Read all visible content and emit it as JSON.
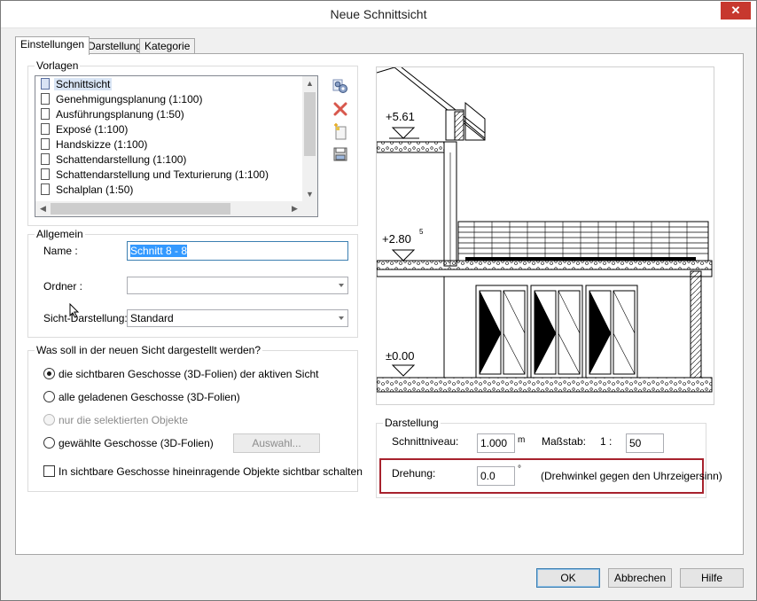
{
  "window": {
    "title": "Neue Schnittsicht",
    "close_glyph": "✕"
  },
  "tabs": [
    "Einstellungen",
    "Darstellung",
    "Kategorie"
  ],
  "vorlagen": {
    "legend": "Vorlagen",
    "items": [
      "Schnittsicht",
      "Genehmigungsplanung (1:100)",
      "Ausführungsplanung (1:50)",
      "Exposé (1:100)",
      "Handskizze (1:100)",
      "Schattendarstellung (1:100)",
      "Schattendarstellung und Texturierung (1:100)",
      "Schalplan (1:50)"
    ],
    "side_buttons": [
      "settings-gear-icon",
      "delete-x-icon",
      "new-template-icon",
      "save-template-icon"
    ]
  },
  "allgemein": {
    "legend": "Allgemein",
    "name_label": "Name :",
    "name_value": "Schnitt 8 - 8",
    "ordner_label": "Ordner :",
    "ordner_value": "",
    "sicht_label": "Sicht-Darstellung:",
    "sicht_value": "Standard"
  },
  "dargestellt": {
    "legend": "Was soll in der neuen Sicht dargestellt werden?",
    "options": [
      {
        "label": "die sichtbaren Geschosse (3D-Folien) der aktiven Sicht",
        "checked": true,
        "disabled": false
      },
      {
        "label": "alle geladenen Geschosse (3D-Folien)",
        "checked": false,
        "disabled": false
      },
      {
        "label": "nur die selektierten Objekte",
        "checked": false,
        "disabled": true
      },
      {
        "label": "gewählte Geschosse (3D-Folien)",
        "checked": false,
        "disabled": false
      }
    ],
    "auswahl_button": "Auswahl...",
    "checkbox_label": "In sichtbare Geschosse hineinragende Objekte sichtbar schalten"
  },
  "preview": {
    "levels": [
      "+5.61",
      "+2.80",
      "±0.00"
    ],
    "superscript": "5"
  },
  "darstellung": {
    "legend": "Darstellung",
    "schnittniveau_label": "Schnittniveau:",
    "schnittniveau_value": "1.000",
    "schnittniveau_unit": "m",
    "massstab_label": "Maßstab:",
    "massstab_prefix": "1  :",
    "massstab_value": "50",
    "drehung_label": "Drehung:",
    "drehung_value": "0.0",
    "drehung_unit": "°",
    "drehung_hint": "(Drehwinkel gegen den Uhrzeigersinn)"
  },
  "footer": {
    "ok": "OK",
    "cancel": "Abbrechen",
    "help": "Hilfe"
  },
  "colors": {
    "highlight": "#a7222d",
    "selection": "#d9e5f5",
    "close": "#c7382e"
  }
}
